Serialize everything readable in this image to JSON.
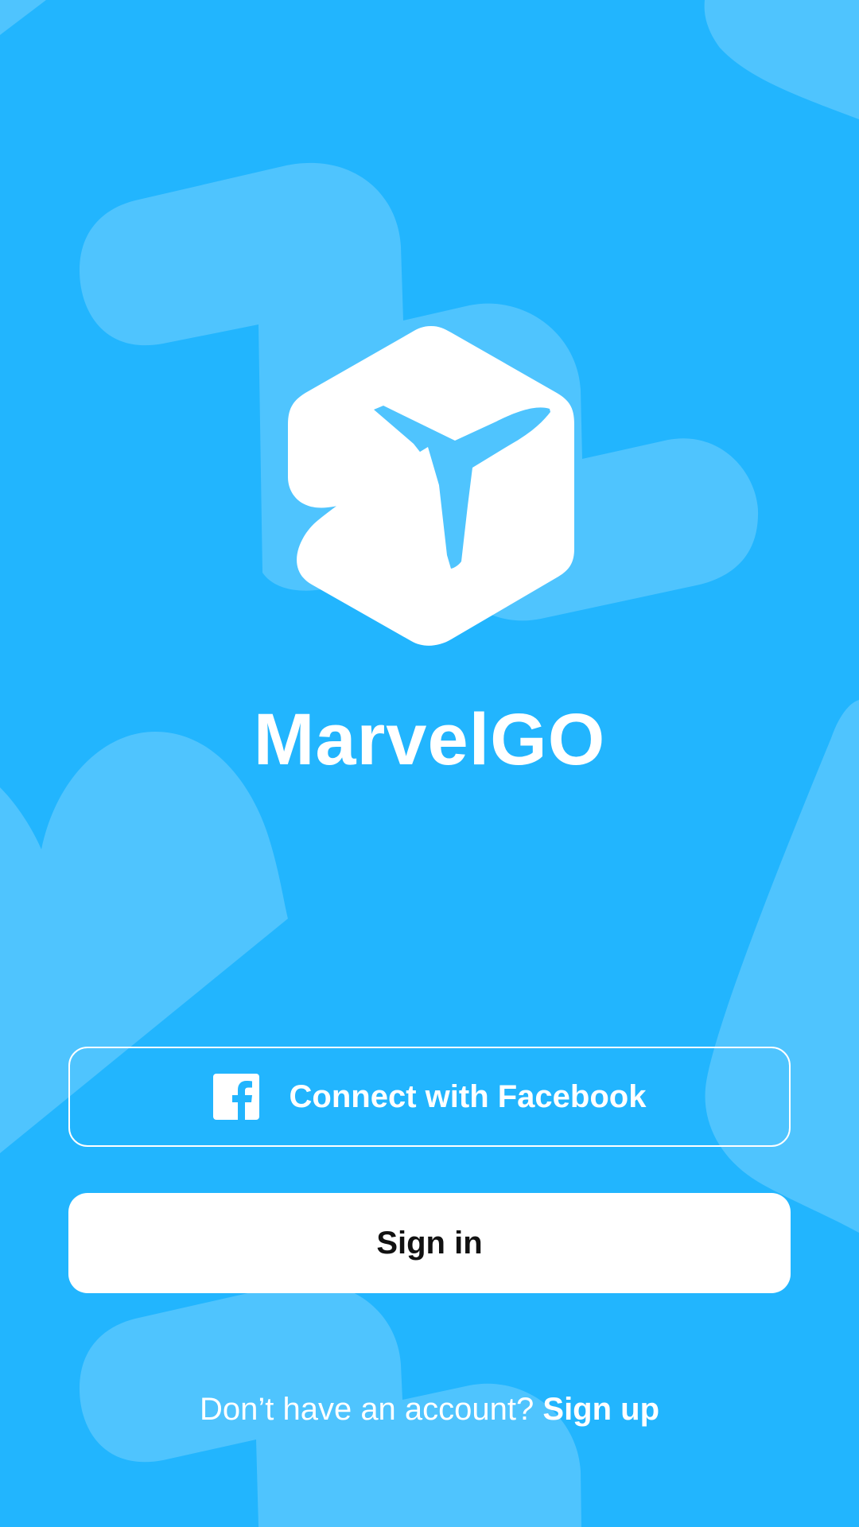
{
  "app": {
    "title": "MarvelGO",
    "logo_icon": "airplane-cube-logo"
  },
  "colors": {
    "background": "#22B5FE",
    "background_shapes": "#4FC4FE",
    "primary_text": "#FFFFFF",
    "signin_text": "#111111"
  },
  "actions": {
    "facebook_label": "Connect with Facebook",
    "facebook_icon": "facebook-icon",
    "signin_label": "Sign in"
  },
  "footer": {
    "prompt": "Don’t have an account?",
    "signup_label": "Sign up"
  }
}
